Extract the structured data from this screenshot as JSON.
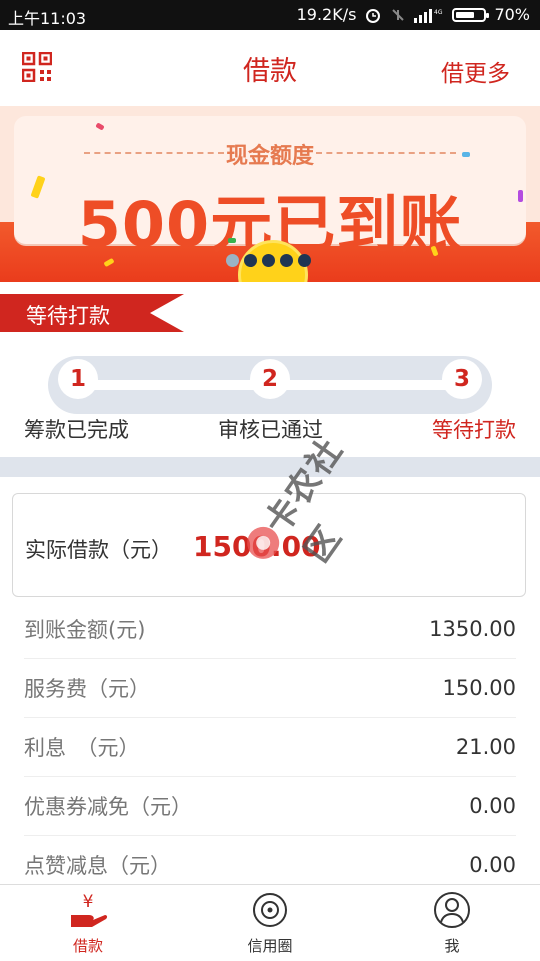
{
  "status_bar": {
    "time": "上午11:03",
    "speed": "19.2K/s",
    "battery": "70%",
    "battery_level": 0.7
  },
  "header": {
    "title": "借款",
    "more": "借更多",
    "qr_icon": "qr-code-icon"
  },
  "banner": {
    "subtitle": "现金额度",
    "headline": "500元已到账",
    "carousel_total": 5,
    "carousel_active": 1
  },
  "status_tag": "等待打款",
  "steps": [
    {
      "number": "1",
      "label": "筹款已完成",
      "state": "done"
    },
    {
      "number": "2",
      "label": "审核已通过",
      "state": "done"
    },
    {
      "number": "3",
      "label": "等待打款",
      "state": "current"
    }
  ],
  "loan": {
    "label": "实际借款（元）",
    "value": "1500.00"
  },
  "details": [
    {
      "label": "到账金额(元)",
      "value": "1350.00"
    },
    {
      "label": "服务费（元）",
      "value": "150.00"
    },
    {
      "label": "利息　（元）",
      "value": "21.00"
    },
    {
      "label": "优惠券减免（元）",
      "value": "0.00"
    },
    {
      "label": "点赞减息（元）",
      "value": "0.00"
    }
  ],
  "watermark": "卡农社区",
  "tabs": [
    {
      "label": "借款",
      "icon": "yen-hand-icon",
      "active": true
    },
    {
      "label": "信用圈",
      "icon": "credit-circle-icon",
      "active": false
    },
    {
      "label": "我",
      "icon": "user-icon",
      "active": false
    }
  ],
  "colors": {
    "brand": "#d0261f",
    "banner_red": "#ee4d26",
    "step_track": "#dfe4ec"
  }
}
